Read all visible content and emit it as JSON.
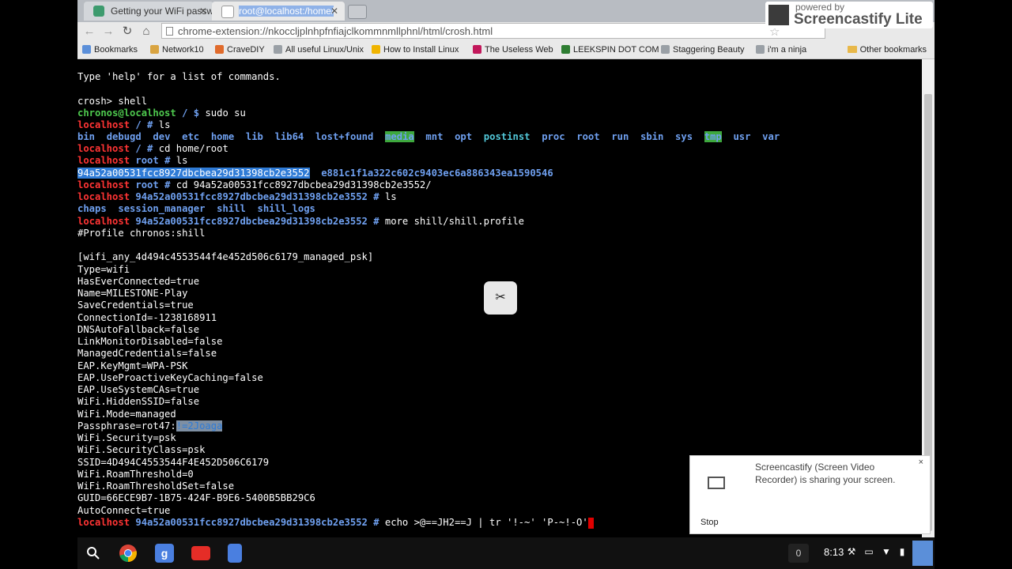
{
  "tabs": [
    {
      "label": "Getting your WiFi passw",
      "active": false
    },
    {
      "label": "root@localhost:/home/",
      "active": true
    }
  ],
  "address_bar": {
    "url": "chrome-extension://nkoccljplnhpfnfiajclkommnmllphnl/html/crosh.html"
  },
  "bookmarks": [
    {
      "label": "Bookmarks",
      "color": "#5b8fd9"
    },
    {
      "label": "Network10",
      "color": "#d9a441"
    },
    {
      "label": "CraveDIY",
      "color": "#e06b2c"
    },
    {
      "label": "All useful Linux/Unix",
      "color": "#9aa0a6"
    },
    {
      "label": "How to Install Linux",
      "color": "#f0b400"
    },
    {
      "label": "The Useless Web",
      "color": "#c2185b"
    },
    {
      "label": "LEEKSPIN DOT COM",
      "color": "#2e7d32"
    },
    {
      "label": "Staggering Beauty",
      "color": "#9aa0a6"
    },
    {
      "label": "i'm a ninja",
      "color": "#9aa0a6"
    }
  ],
  "other_bookmarks": "Other bookmarks",
  "screencastify": {
    "powered_by": "powered by",
    "name": "Screencastify Lite"
  },
  "terminal": {
    "help": "Type 'help' for a list of commands.",
    "prompt_crosh": "crosh> shell",
    "chronos_user": "chronos@localhost",
    "chronos_path": " / $ ",
    "cmd_sudo": "sudo su",
    "host": "localhost",
    "path_root_dir": " / # ",
    "cmd_ls": "ls",
    "dirs": [
      "bin",
      "debugd",
      "dev",
      "etc",
      "home",
      "lib",
      "lib64",
      "lost+found",
      "media",
      "mnt",
      "opt",
      "postinst",
      "proc",
      "root",
      "run",
      "sbin",
      "sys",
      "tmp",
      "usr",
      "var"
    ],
    "cmd_cd_home": "cd home/root",
    "path_root": " root # ",
    "hash1": "94a52a00531fcc8927dbcbea29d31398cb2e3552",
    "hash2": "e881c1f1a322c602c9403ec6a886343ea1590546",
    "cmd_cd_hash": "cd 94a52a00531fcc8927dbcbea29d31398cb2e3552/",
    "path_hash": " 94a52a00531fcc8927dbcbea29d31398cb2e3552 # ",
    "subdirs": [
      "chaps",
      "session_manager",
      "shill",
      "shill_logs"
    ],
    "cmd_more": "more shill/shill.profile",
    "profile_lines": [
      "#Profile chronos:shill",
      "",
      "[wifi_any_4d494c4553544f4e452d506c6179_managed_psk]",
      "Type=wifi",
      "HasEverConnected=true",
      "Name=MILESTONE-Play",
      "SaveCredentials=true",
      "ConnectionId=-1238168911",
      "DNSAutoFallback=false",
      "LinkMonitorDisabled=false",
      "ManagedCredentials=false",
      "EAP.KeyMgmt=WPA-PSK",
      "EAP.UseProactiveKeyCaching=false",
      "EAP.UseSystemCAs=true",
      "WiFi.HiddenSSID=false",
      "WiFi.Mode=managed"
    ],
    "passphrase_prefix": "Passphrase=rot47:",
    "passphrase_value": "!=2Joaga",
    "profile_tail": [
      "WiFi.Security=psk",
      "WiFi.SecurityClass=psk",
      "SSID=4D494C4553544F4E452D506C6179",
      "WiFi.RoamThreshold=0",
      "WiFi.RoamThresholdSet=false",
      "GUID=66ECE9B7-1B75-424F-B9E6-5400B5BB29C6",
      "AutoConnect=true"
    ],
    "cmd_echo": "echo >@==JH2==J | tr '!-~' 'P-~!-O'"
  },
  "notification": {
    "text": "Screencastify (Screen Video Recorder) is sharing your screen.",
    "stop": "Stop",
    "close": "×"
  },
  "shelf": {
    "notification_count": "0",
    "clock": "8:13"
  }
}
